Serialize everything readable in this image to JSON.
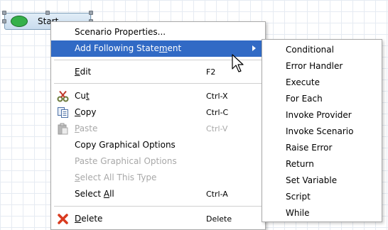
{
  "canvas": {
    "start_node_label": "Start",
    "node_fill": "#c9dcee",
    "node_circle_color": "#35b04a"
  },
  "context_menu": {
    "highlight_color": "#316ac5",
    "items": [
      {
        "label": "Scenario Properties...",
        "shortcut": "",
        "enabled": true
      },
      {
        "pre": "Add Following State",
        "mn": "m",
        "post": "ent",
        "shortcut": "",
        "enabled": true,
        "submenu": true,
        "highlighted": true
      },
      {
        "pre": "",
        "mn": "E",
        "post": "dit",
        "shortcut": "F2",
        "enabled": true
      },
      {
        "pre": "Cu",
        "mn": "t",
        "post": "",
        "shortcut": "Ctrl-X",
        "enabled": true,
        "icon": "scissors-icon"
      },
      {
        "pre": "",
        "mn": "C",
        "post": "opy",
        "shortcut": "Ctrl-C",
        "enabled": true,
        "icon": "copy-icon"
      },
      {
        "pre": "",
        "mn": "P",
        "post": "aste",
        "shortcut": "Ctrl-V",
        "enabled": false,
        "icon": "paste-icon"
      },
      {
        "label": "Copy Graphical Options",
        "shortcut": "",
        "enabled": true
      },
      {
        "label": "Paste Graphical Options",
        "shortcut": "",
        "enabled": false
      },
      {
        "pre": "",
        "mn": "S",
        "post": "elect All This Type",
        "shortcut": "",
        "enabled": false
      },
      {
        "pre": "Select ",
        "mn": "A",
        "post": "ll",
        "shortcut": "Ctrl-A",
        "enabled": true
      },
      {
        "pre": "",
        "mn": "D",
        "post": "elete",
        "shortcut": "Delete",
        "enabled": true,
        "icon": "delete-icon"
      }
    ]
  },
  "submenu": {
    "items": [
      "Conditional",
      "Error Handler",
      "Execute",
      "For Each",
      "Invoke Provider",
      "Invoke Scenario",
      "Raise Error",
      "Return",
      "Set Variable",
      "Script",
      "While"
    ]
  }
}
